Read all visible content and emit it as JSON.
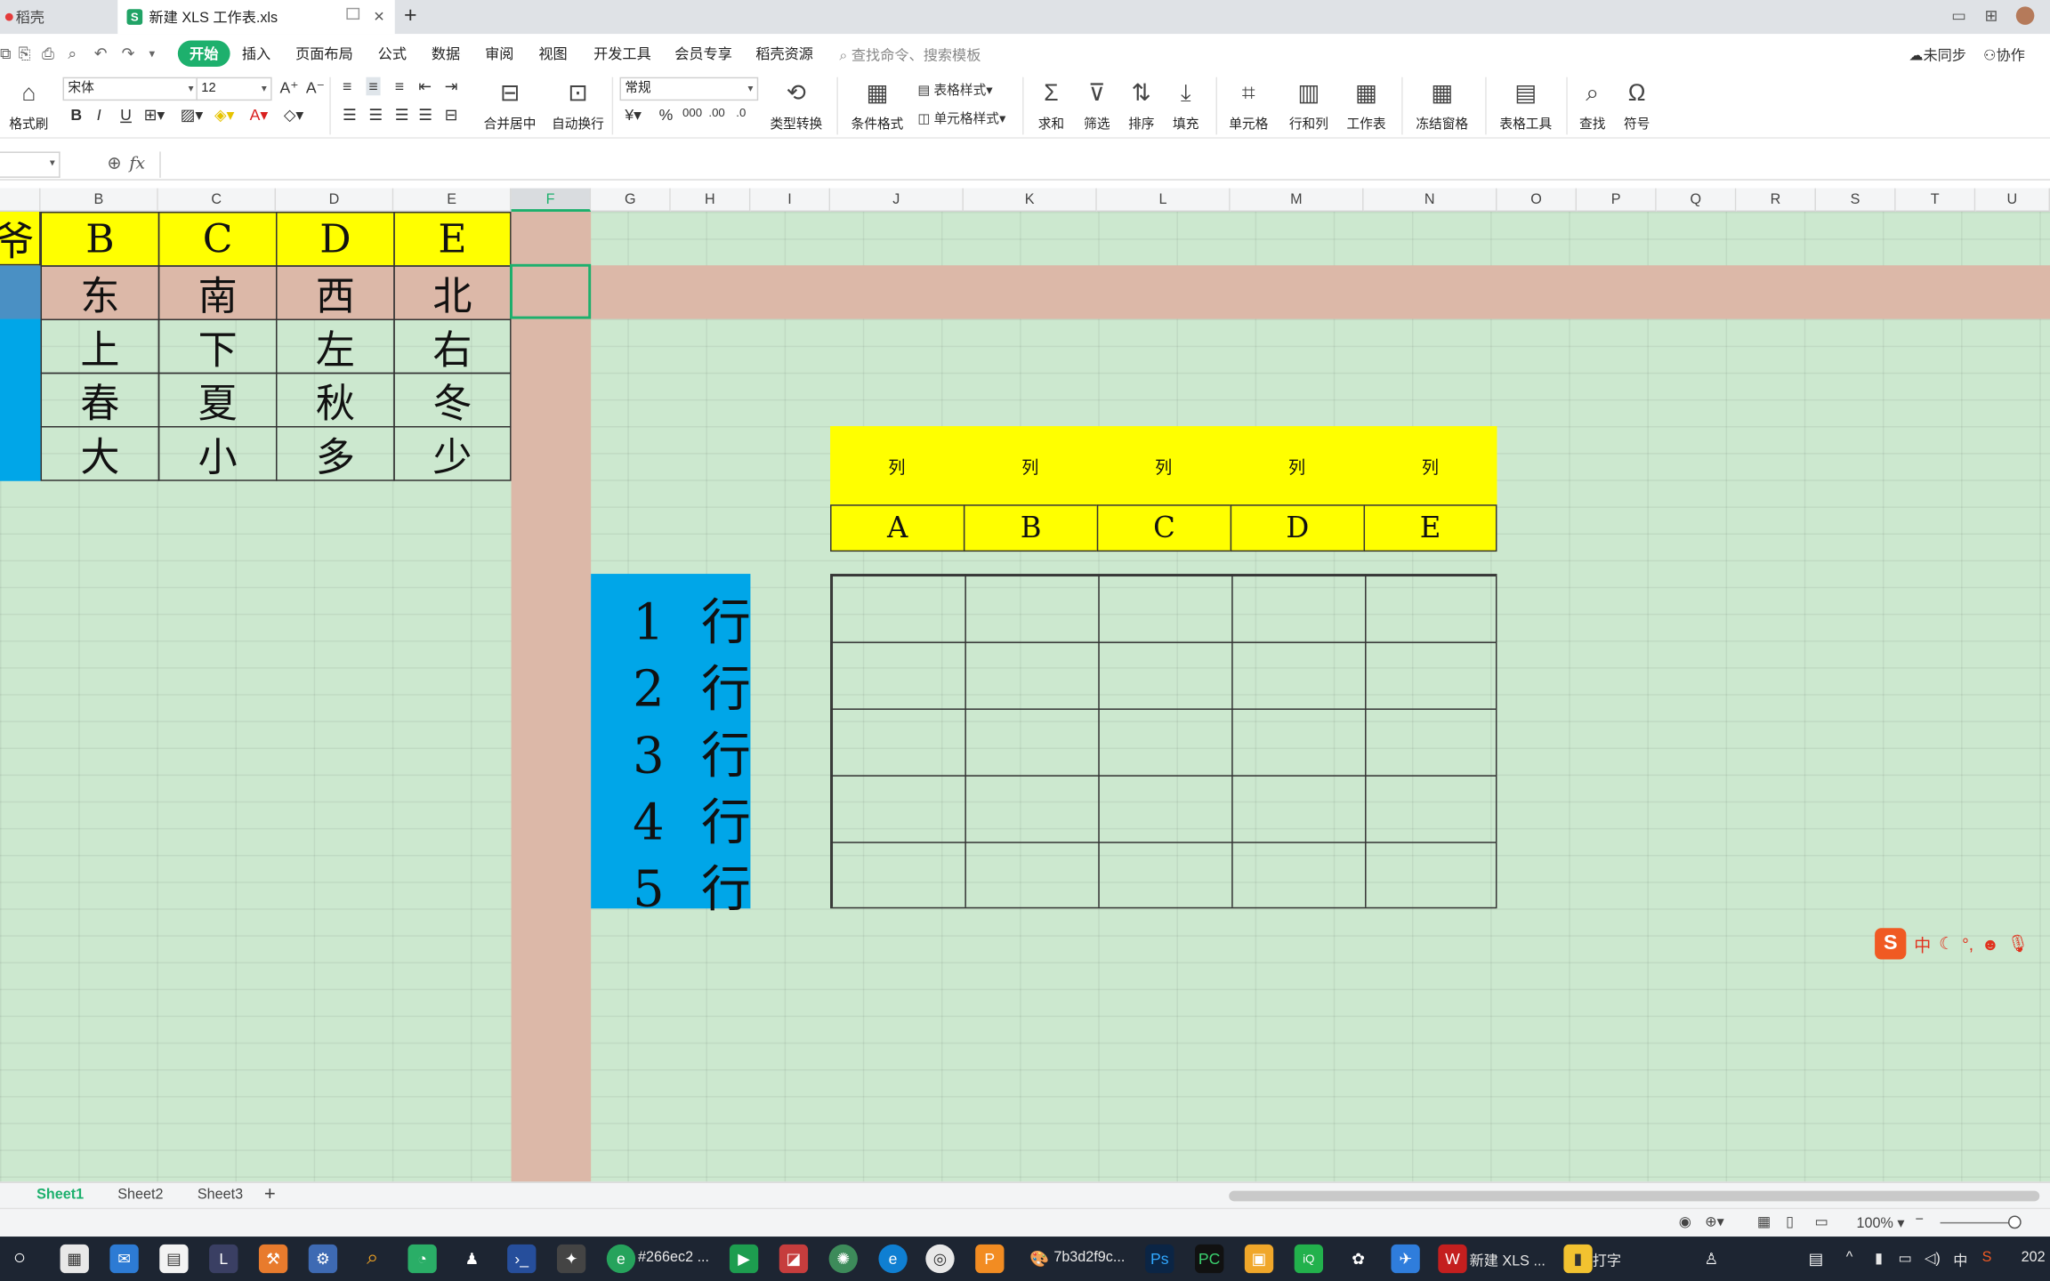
{
  "tabs": [
    {
      "label": "稻壳"
    },
    {
      "label": "新建 XLS 工作表.xls"
    }
  ],
  "menu": {
    "items": [
      "开始",
      "插入",
      "页面布局",
      "公式",
      "数据",
      "审阅",
      "视图",
      "开发工具",
      "会员专享",
      "稻壳资源"
    ],
    "search_placeholder": "查找命令、搜索模板",
    "sync": "未同步",
    "collab": "协作"
  },
  "ribbon": {
    "format_painter": "格式刷",
    "font_name": "宋体",
    "font_size": "12",
    "merge": "合并居中",
    "wrap": "自动换行",
    "number_format": "常规",
    "convert": "类型转换",
    "cond_format": "条件格式",
    "table_style": "表格样式",
    "cell_style": "单元格样式",
    "sum": "求和",
    "filter": "筛选",
    "sort": "排序",
    "fill": "填充",
    "cell": "单元格",
    "row_col": "行和列",
    "worksheet": "工作表",
    "freeze": "冻结窗格",
    "table_tools": "表格工具",
    "find": "查找",
    "symbol": "符号"
  },
  "formula_bar": {
    "fx": "fx",
    "value": ""
  },
  "columns": [
    "B",
    "C",
    "D",
    "E",
    "F",
    "G",
    "H",
    "I",
    "J",
    "K",
    "L",
    "M",
    "N",
    "O",
    "P",
    "Q",
    "R",
    "S",
    "T",
    "U"
  ],
  "left_table": {
    "header": [
      "爷",
      "B",
      "C",
      "D",
      "E"
    ],
    "rows": [
      [
        "东",
        "南",
        "西",
        "北"
      ],
      [
        "上",
        "下",
        "左",
        "右"
      ],
      [
        "春",
        "夏",
        "秋",
        "冬"
      ],
      [
        "大",
        "小",
        "多",
        "少"
      ]
    ]
  },
  "row_labels": [
    "1 行",
    "2 行",
    "3 行",
    "4 行",
    "5 行"
  ],
  "right_table": {
    "top_labels": [
      "列",
      "列",
      "列",
      "列",
      "列"
    ],
    "letters": [
      "A",
      "B",
      "C",
      "D",
      "E"
    ]
  },
  "sheets": [
    "Sheet1",
    "Sheet2",
    "Sheet3"
  ],
  "status": {
    "zoom": "100%"
  },
  "taskbar": {
    "item1": "#266ec2 ...",
    "item2": "7b3d2f9c...",
    "item3": "新建 XLS ...",
    "item4": "打字",
    "ime": "中",
    "clock": "202"
  },
  "ime_bar": {
    "label": "中"
  },
  "colors": {
    "yellow": "#ffff00",
    "blue": "#00a6e8",
    "rose": "#dcb8a8",
    "sheet_green": "#cce8cf",
    "accent": "#1db06d"
  }
}
